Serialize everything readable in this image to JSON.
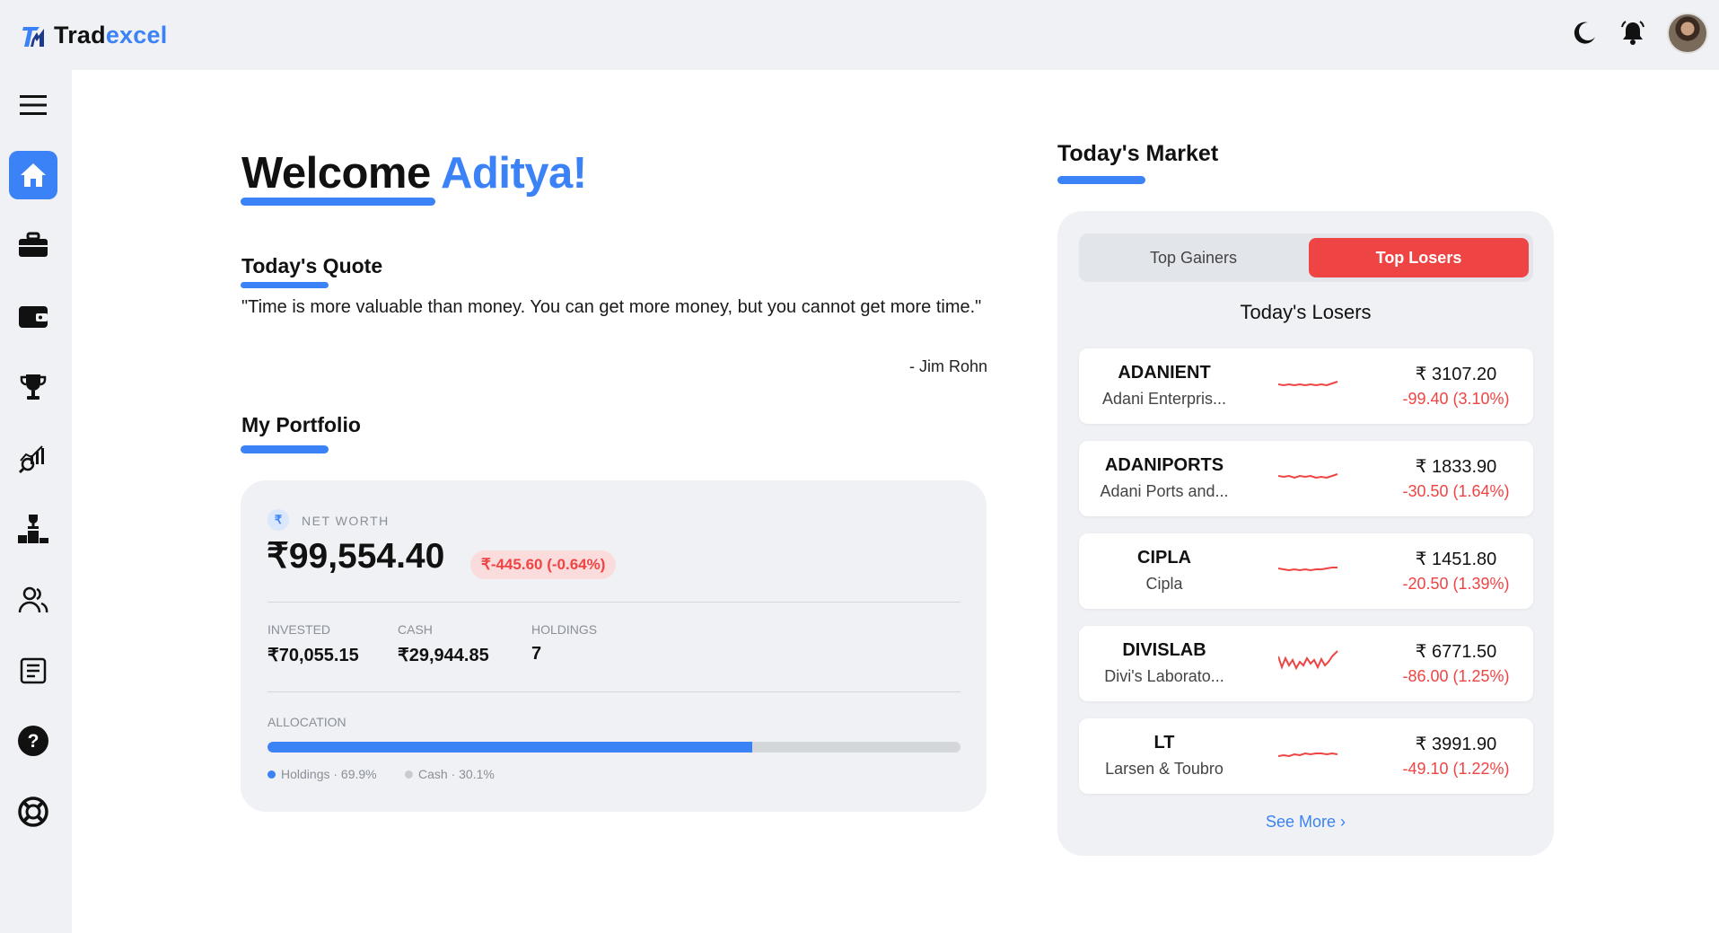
{
  "app": {
    "logo_part1": "Trad",
    "logo_part2": "excel",
    "accent": "#3b82f6",
    "loss_color": "#ef4444"
  },
  "topbar": {
    "icons": [
      "moon-icon",
      "bell-icon",
      "avatar"
    ]
  },
  "sidebar": {
    "items": [
      "menu-icon",
      "home-icon",
      "briefcase-icon",
      "wallet-icon",
      "trophy-icon",
      "chart-search-icon",
      "leaderboard-icon",
      "users-icon",
      "document-icon",
      "help-icon",
      "lifebuoy-icon"
    ],
    "active": "home-icon"
  },
  "welcome": {
    "prefix": "Welcome",
    "name": "Aditya!"
  },
  "quote": {
    "title": "Today's Quote",
    "text": "\"Time is more valuable than money. You can get more money, but you cannot get more time.\"",
    "author": "- Jim Rohn"
  },
  "portfolio": {
    "title": "My Portfolio",
    "currency_symbol": "₹",
    "net_worth_label": "NET WORTH",
    "net_worth": "₹99,554.40",
    "change": "₹-445.60 (-0.64%)",
    "invested_label": "INVESTED",
    "invested": "₹70,055.15",
    "cash_label": "CASH",
    "cash": "₹29,944.85",
    "holdings_label": "HOLDINGS",
    "holdings": "7",
    "allocation_label": "ALLOCATION",
    "allocation_holdings_fraction": 0.699,
    "legend_holdings": "Holdings · 69.9%",
    "legend_cash": "Cash · 30.1%"
  },
  "market": {
    "title": "Today's Market",
    "tab_gainers": "Top Gainers",
    "tab_losers": "Top Losers",
    "active_tab": "Top Losers",
    "list_title": "Today's Losers",
    "see_more": "See More ›",
    "stocks": [
      {
        "symbol": "ADANIENT",
        "name": "Adani Enterpris...",
        "price": "₹ 3107.20",
        "change": "-99.40 (3.10%)"
      },
      {
        "symbol": "ADANIPORTS",
        "name": "Adani Ports and...",
        "price": "₹ 1833.90",
        "change": "-30.50 (1.64%)"
      },
      {
        "symbol": "CIPLA",
        "name": "Cipla",
        "price": "₹ 1451.80",
        "change": "-20.50 (1.39%)"
      },
      {
        "symbol": "DIVISLAB",
        "name": "Divi's Laborato...",
        "price": "₹ 6771.50",
        "change": "-86.00 (1.25%)"
      },
      {
        "symbol": "LT",
        "name": "Larsen & Toubro",
        "price": "₹ 3991.90",
        "change": "-49.10 (1.22%)"
      }
    ]
  }
}
